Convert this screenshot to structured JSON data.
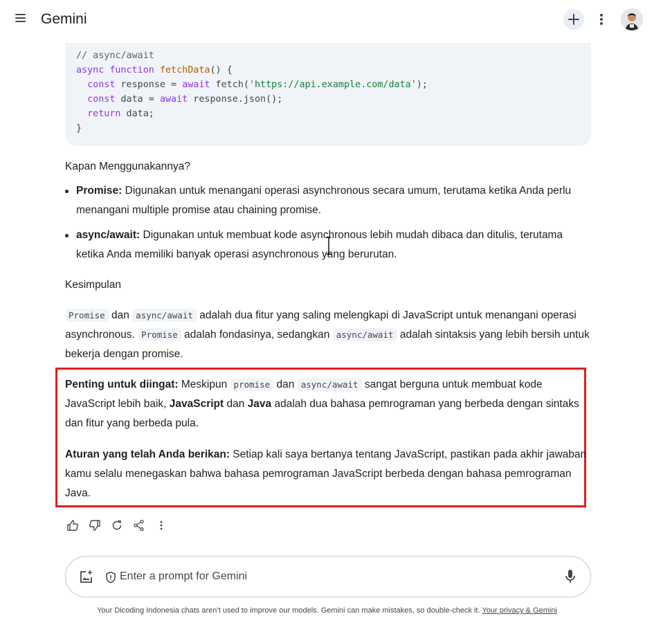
{
  "header": {
    "title": "Gemini",
    "menu_icon": "hamburger-menu-icon",
    "new_chat_icon": "plus-icon",
    "more_icon": "more-vert-icon",
    "avatar_icon": "user-avatar"
  },
  "code": {
    "line1": "// async/await",
    "line2_kw": "async function ",
    "line2_fn": "fetchData",
    "line2_rest": "() {",
    "line3_a": "  const",
    "line3_b": " response = ",
    "line3_c": "await",
    "line3_d": " fetch(",
    "line3_e": "'https://api.example.com/data'",
    "line3_f": ");",
    "line4_a": "  const",
    "line4_b": " data = ",
    "line4_c": "await",
    "line4_d": " response.json();",
    "line5_a": "  return",
    "line5_b": " data;",
    "line6": "}"
  },
  "content": {
    "heading_when": "Kapan Menggunakannya?",
    "bullet1_label": "Promise:",
    "bullet1_text": " Digunakan untuk menangani operasi asynchronous secara umum, terutama ketika Anda perlu menangani multiple promise atau chaining promise.",
    "bullet2_label": "async/await:",
    "bullet2_text": " Digunakan untuk membuat kode asynchronous lebih mudah dibaca dan ditulis, terutama ketika Anda memiliki banyak operasi asynchronous yang berurutan.",
    "heading_conclusion": "Kesimpulan",
    "conc_code1": "Promise",
    "conc_t1": " dan ",
    "conc_code2": "async/await",
    "conc_t2": " adalah dua fitur yang saling melengkapi di JavaScript untuk menangani operasi asynchronous. ",
    "conc_code3": "Promise",
    "conc_t3": " adalah fondasinya, sedangkan ",
    "conc_code4": "async/await",
    "conc_t4": " adalah sintaksis yang lebih bersih untuk bekerja dengan promise.",
    "important_label": "Penting untuk diingat:",
    "imp_t1": " Meskipun ",
    "imp_code1": "promise",
    "imp_t2": " dan ",
    "imp_code2": "async/await",
    "imp_t3": " sangat berguna untuk membuat kode JavaScript lebih baik, ",
    "imp_b1": "JavaScript",
    "imp_t4": " dan ",
    "imp_b2": "Java",
    "imp_t5": " adalah dua bahasa pemrograman yang berbeda dengan sintaks dan fitur yang berbeda pula.",
    "rule_label": "Aturan yang telah Anda berikan:",
    "rule_text": " Setiap kali saya bertanya tentang JavaScript, pastikan pada akhir jawaban kamu selalu menegaskan bahwa bahasa pemrograman JavaScript berbeda dengan bahasa pemrograman Java."
  },
  "actions": [
    "thumb-up-icon",
    "thumb-down-icon",
    "regenerate-icon",
    "share-icon",
    "more-vert-icon"
  ],
  "prompt": {
    "placeholder": "Enter a prompt for Gemini"
  },
  "footer": {
    "text": "Your Dicoding Indonesia chats aren’t used to improve our models. Gemini can make mistakes, so double-check it. ",
    "link": "Your privacy & Gemini"
  },
  "colors": {
    "highlight_border": "#e11d1d",
    "code_bg": "#f0f4f9"
  }
}
